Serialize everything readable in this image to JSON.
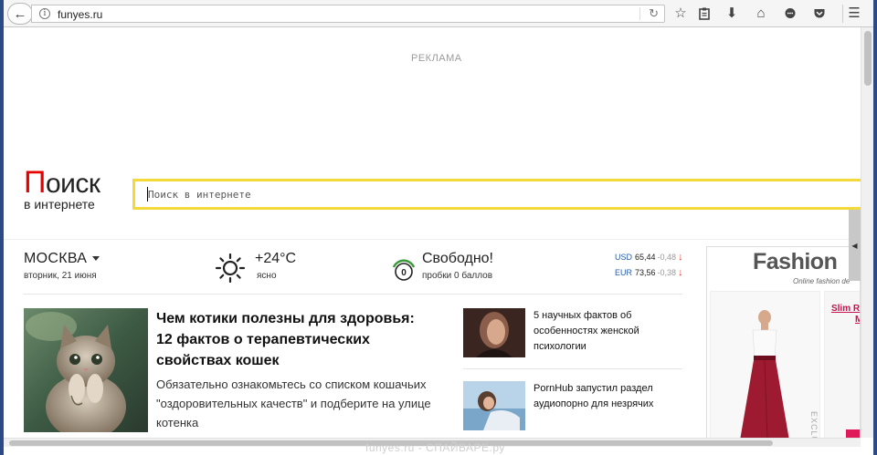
{
  "browser": {
    "url": "funyes.ru",
    "icons": [
      "back-arrow-icon",
      "info-icon",
      "reload-icon",
      "star-icon",
      "clipboard-icon",
      "download-icon",
      "home-icon",
      "chat-icon",
      "pocket-icon",
      "menu-icon"
    ]
  },
  "page": {
    "ad_label": "РЕКЛАМА",
    "logo": {
      "first_letter": "П",
      "rest": "оиск",
      "subtitle": "в интернете"
    },
    "search": {
      "placeholder": "Поиск в интернете"
    },
    "city": {
      "name": "МОСКВА",
      "date": "вторник, 21 июня"
    },
    "weather": {
      "temp": "+24°C",
      "desc": "ясно"
    },
    "traffic": {
      "title": "Свободно!",
      "desc": "пробки 0 баллов",
      "score": "0"
    },
    "currency": [
      {
        "code": "USD",
        "value": "65,44",
        "change": "-0,48",
        "arrow": "↓"
      },
      {
        "code": "EUR",
        "value": "73,56",
        "change": "-0,38",
        "arrow": "↓"
      }
    ],
    "main_news": {
      "title": "Чем котики полезны для здоровья: 12 фактов о терапевтических свойствах кошек",
      "desc": "Обязательно ознакомьтесь со списком кошачьих \"оздоровительных качеств\" и подберите на улице котенка"
    },
    "side_news": [
      {
        "title": "5 научных фактов об особенностях женской психологии"
      },
      {
        "title": "PornHub запустил раздел аудиопорно для незрячих"
      }
    ],
    "fashion_ad": {
      "title": "Fashion",
      "subtitle": "Online fashion de",
      "slim": "Slim R",
      "slim2": "M",
      "exclu": "EXCLU"
    }
  },
  "watermark": "funyes.ru - СПАЙВАРЕ.ру",
  "colors": {
    "accent_yellow": "#f4d93b",
    "logo_red": "#e60000",
    "link_blue": "#2a5caa",
    "down_red": "#e03c31",
    "traffic_green": "#3c9a3c"
  }
}
